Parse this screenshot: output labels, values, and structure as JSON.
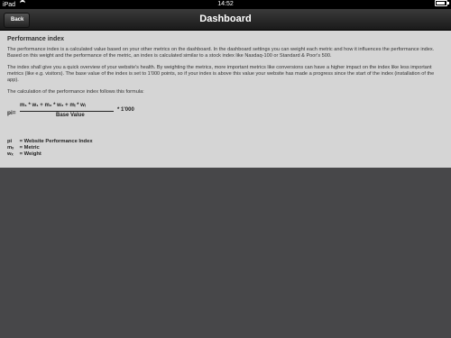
{
  "status_bar": {
    "device": "iPad",
    "time": "14:52"
  },
  "nav": {
    "title": "Dashboard",
    "back_label": "Back"
  },
  "content": {
    "heading": "Performance index",
    "paragraphs": [
      "The performance index is a calculated value based on your other metrics on the dashboard. In the dashboard settings you can weight each metric and how it influences the performance index. Based on this weight and the performance of the metric, an index is calculated similar to a stock index like Nasdaq-100 or Standard & Poor's 500.",
      "The index shall give you a quick overview of your website's health. By weighting the metrics, more important metrics like conversions can have a higher impact on the index like less important metrics (like e.g. visitors). The base value of the index is set to 1'000 points, so if your index is above this value your website has made a progress since the start of the index (installation of the app).",
      "The calculation of the performance index follows this formula:"
    ],
    "formula": {
      "lhs": "pi=",
      "numerator": "m₁ * w₁ + m₂ * w₂ + mᵢ * wᵢ",
      "denominator": "Base Value",
      "rhs": "* 1'000"
    },
    "legend": [
      {
        "symbol": "pi",
        "text": "= Website Performance Index"
      },
      {
        "symbol": "mₓ",
        "text": "= Metric"
      },
      {
        "symbol": "wₓ",
        "text": "= Weight"
      }
    ]
  }
}
